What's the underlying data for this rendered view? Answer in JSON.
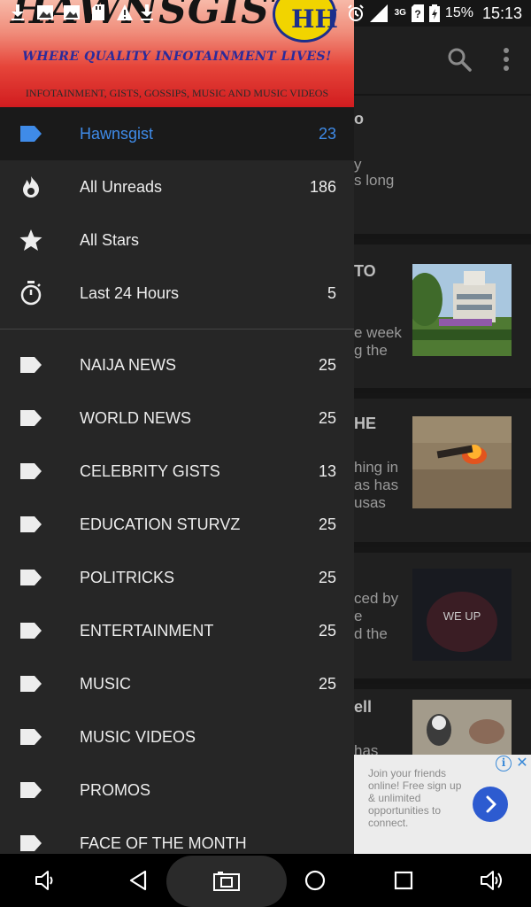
{
  "status_bar": {
    "notification_icons": [
      "download-icon",
      "gallery-icon",
      "gallery-icon",
      "sd-card-icon",
      "warning-icon",
      "download-icon",
      "settings-icon"
    ],
    "alarm_icon": "alarm-icon",
    "network_label": "3G",
    "battery_percent": "15%",
    "time": "15:13"
  },
  "drawer": {
    "banner": {
      "logo_text": "HAWNSGIST",
      "emblem_text": "HH",
      "tagline": "WHERE QUALITY INFOTAINMENT LIVES!",
      "subtitle": "INFOTAINMENT, GISTS, GOSSIPS, MUSIC AND MUSIC VIDEOS"
    },
    "items": [
      {
        "label": "Hawnsgist",
        "count": "23",
        "icon": "label-icon",
        "active": true
      },
      {
        "label": "All Unreads",
        "count": "186",
        "icon": "fire-icon"
      },
      {
        "label": "All Stars",
        "count": "",
        "icon": "star-icon"
      },
      {
        "label": "Last 24 Hours",
        "count": "5",
        "icon": "stopwatch-icon"
      }
    ],
    "categories": [
      {
        "label": "NAIJA NEWS",
        "count": "25"
      },
      {
        "label": "WORLD NEWS",
        "count": "25"
      },
      {
        "label": "CELEBRITY GISTS",
        "count": "13"
      },
      {
        "label": "EDUCATION STURVZ",
        "count": "25"
      },
      {
        "label": "POLITRICKS",
        "count": "25"
      },
      {
        "label": "ENTERTAINMENT",
        "count": "25"
      },
      {
        "label": "MUSIC",
        "count": "25"
      },
      {
        "label": "MUSIC VIDEOS",
        "count": ""
      },
      {
        "label": "PROMOS",
        "count": ""
      },
      {
        "label": "FACE OF THE MONTH",
        "count": ""
      }
    ]
  },
  "background": {
    "cards": [
      {
        "lines": [
          "o",
          "",
          "y",
          "s long"
        ]
      },
      {
        "lines": [
          "TO",
          "",
          "",
          "e week",
          "g the"
        ]
      },
      {
        "lines": [
          "HE",
          "",
          "",
          "hing in",
          "as has",
          "usas"
        ]
      },
      {
        "lines": [
          "",
          "",
          "ced by",
          "e",
          "d the"
        ]
      },
      {
        "lines": [
          "ell",
          "",
          "",
          "has"
        ]
      }
    ],
    "thumb_caption": "WE UP"
  },
  "ad": {
    "text": "Join your friends online! Free sign up & unlimited opportunities to connect.",
    "info_glyph": "i",
    "close_glyph": "✕"
  },
  "colors": {
    "accent": "#3f8be8",
    "drawer_bg": "#262626",
    "active_row_bg": "#1a1a1a",
    "banner_red": "#d11c1f"
  }
}
